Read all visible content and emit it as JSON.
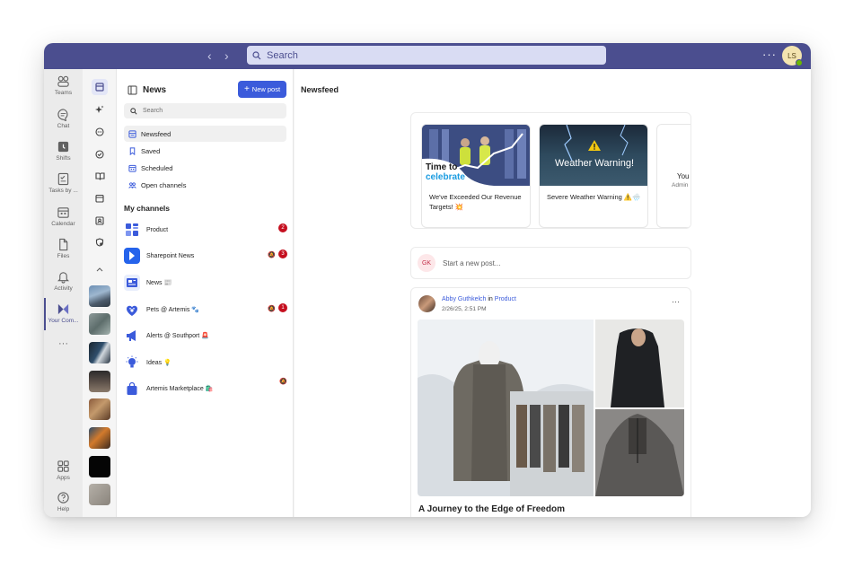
{
  "titlebar": {
    "back_glyph": "‹",
    "forward_glyph": "›",
    "search_placeholder": "Search",
    "more_glyph": "···",
    "user_initials": "LS"
  },
  "rail": {
    "items": [
      {
        "label": "Teams",
        "icon": "teams-icon"
      },
      {
        "label": "Chat",
        "icon": "chat-icon"
      },
      {
        "label": "Shifts",
        "icon": "shifts-icon"
      },
      {
        "label": "Tasks by ...",
        "icon": "tasks-icon"
      },
      {
        "label": "Calendar",
        "icon": "calendar-icon"
      },
      {
        "label": "Files",
        "icon": "files-icon"
      },
      {
        "label": "Activity",
        "icon": "bell-icon"
      },
      {
        "label": "Your Com...",
        "icon": "viva-engage-icon"
      }
    ],
    "more_glyph": "···",
    "apps_label": "Apps",
    "help_label": "Help",
    "accent": "#4b4e8f"
  },
  "left_panel": {
    "title": "News",
    "new_post_label": "New post",
    "search_placeholder": "Search",
    "nav": [
      {
        "label": "Newsfeed"
      },
      {
        "label": "Saved"
      },
      {
        "label": "Scheduled"
      },
      {
        "label": "Open channels"
      }
    ],
    "section_title": "My channels",
    "channels": [
      {
        "name": "Product",
        "badge": "2"
      },
      {
        "name": "Sharepoint News",
        "badge": "3"
      },
      {
        "name": "News 📰"
      },
      {
        "name": "Pets @ Artemis 🐾",
        "badge": "1"
      },
      {
        "name": "Alerts @ Southport 🚨"
      },
      {
        "name": "Ideas 💡"
      },
      {
        "name": "Artemis Marketplace 🛍️"
      }
    ]
  },
  "main": {
    "title": "Newsfeed",
    "cards": [
      {
        "image_text_line1": "Time to",
        "image_text_line2": "celebrate",
        "caption": "We've Exceeded Our Revenue Targets! 💥"
      },
      {
        "image_text": "Weather Warning!",
        "caption": "Severe Weather Warning ⚠️🌧️"
      },
      {
        "caption_line1": "You",
        "caption_line2": "Admin"
      }
    ],
    "composer_initials": "GK",
    "composer_placeholder": "Start a new post...",
    "post": {
      "author": "Abby Guthkelch",
      "in_text": "in",
      "channel": "Product",
      "date": "2/26/25, 2:51 PM",
      "more_glyph": "···",
      "title": "A Journey to the Edge of Freedom"
    }
  },
  "colors": {
    "titlebar": "#4b4e8f",
    "primary_button": "#3b5bdb",
    "badge": "#c50f1f"
  }
}
